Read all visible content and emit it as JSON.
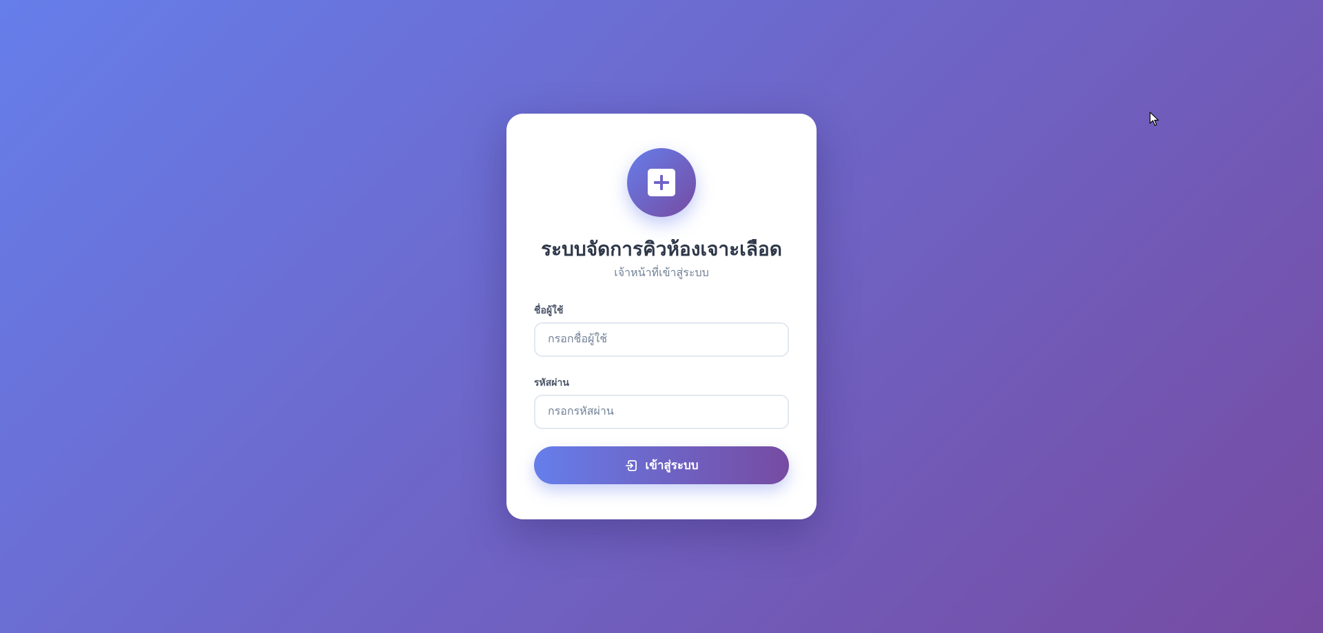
{
  "login": {
    "logo_icon": "medical-plus-icon",
    "title": "ระบบจัดการคิวห้องเจาะเลือด",
    "subtitle": "เจ้าหน้าที่เข้าสู่ระบบ",
    "username": {
      "label": "ชื่อผู้ใช้",
      "placeholder": "กรอกชื่อผู้ใช้",
      "value": ""
    },
    "password": {
      "label": "รหัสผ่าน",
      "placeholder": "กรอกรหัสผ่าน",
      "value": ""
    },
    "submit": {
      "icon": "sign-in-icon",
      "label": "เข้าสู่ระบบ"
    }
  },
  "colors": {
    "gradient_start": "#667eea",
    "gradient_end": "#764ba2",
    "title_text": "#2d3748",
    "subtitle_text": "#718096"
  }
}
